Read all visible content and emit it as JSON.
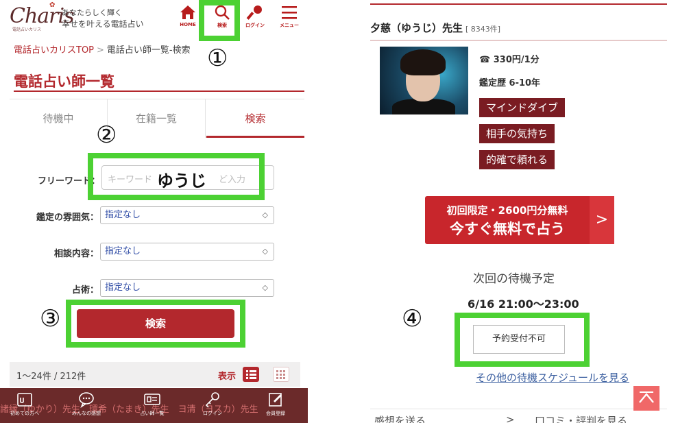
{
  "left": {
    "header": {
      "logo_script": "Charis",
      "logo_sub": "電話占いカリス",
      "tagline_1": "あなたらしく輝く",
      "tagline_2": "幸せを叶える電話占い",
      "nav": [
        {
          "label": "HOME",
          "icon": "home-icon"
        },
        {
          "label": "検索",
          "icon": "search-icon"
        },
        {
          "label": "ログイン",
          "icon": "key-icon"
        },
        {
          "label": "メニュー",
          "icon": "menu-icon"
        }
      ]
    },
    "breadcrumb": {
      "home": "電話占いカリスTOP",
      "separator": ">",
      "current": "電話占い師一覧-検索"
    },
    "page_title": "電話占い師一覧",
    "tabs": [
      {
        "label": "待機中",
        "active": false
      },
      {
        "label": "在籍一覧",
        "active": false
      },
      {
        "label": "検索",
        "active": true
      }
    ],
    "filters": {
      "freeword": {
        "label": "フリーワード：",
        "placeholder_start": "キーワード",
        "placeholder_end": "ど入力",
        "value": "ゆうじ"
      },
      "atmosphere": {
        "label": "鑑定の雰囲気：",
        "value": "指定なし"
      },
      "consultation": {
        "label": "相談内容：",
        "value": "指定なし"
      },
      "divination": {
        "label": "占術：",
        "value": "指定なし"
      }
    },
    "search_button": "検索",
    "results": {
      "count": "1〜24件 / 212件",
      "display_label": "表示"
    },
    "marquee": "諸縁（ゆかり）先生　環希（たまき）先生　ヨ清（ヨスカ）先生",
    "bottom_nav": [
      {
        "label": "初めての方へ",
        "icon": "beginner-icon"
      },
      {
        "label": "みんなの感想",
        "icon": "speech-bubble-icon"
      },
      {
        "label": "占い師一覧",
        "icon": "list-card-icon"
      },
      {
        "label": "ログイン",
        "icon": "key-icon"
      },
      {
        "label": "会員登録",
        "icon": "register-icon"
      }
    ]
  },
  "annotations": [
    "①",
    "②",
    "③",
    "④"
  ],
  "right": {
    "name": "夕慈（ゆうじ）先生",
    "review_count": "[ 8343件]",
    "price": "330円/1分",
    "career": "鑑定歴 6-10年",
    "tags": [
      "マインドダイブ",
      "相手の気持ち",
      "的確で頼れる"
    ],
    "free_button": {
      "line1": "初回限定・2600円分無料",
      "line2": "今すぐ無料で占う",
      "arrow": ">"
    },
    "next_label": "次回の待機予定",
    "next_time": "6/16 21:00〜23:00",
    "reserve_button": "予約受付不可",
    "other_schedule_link": "その他の待機スケジュールを見る",
    "bottom_links": {
      "send": "感想を送る",
      "arrow": ">",
      "reviews": "口コミ・評判を見る"
    }
  },
  "colors": {
    "brand_red": "#b3282d",
    "highlight_green": "#4cd133",
    "nav_bg": "#6b2a2a",
    "tag_bg": "#7a1c22",
    "cta_red": "#c8262c"
  }
}
